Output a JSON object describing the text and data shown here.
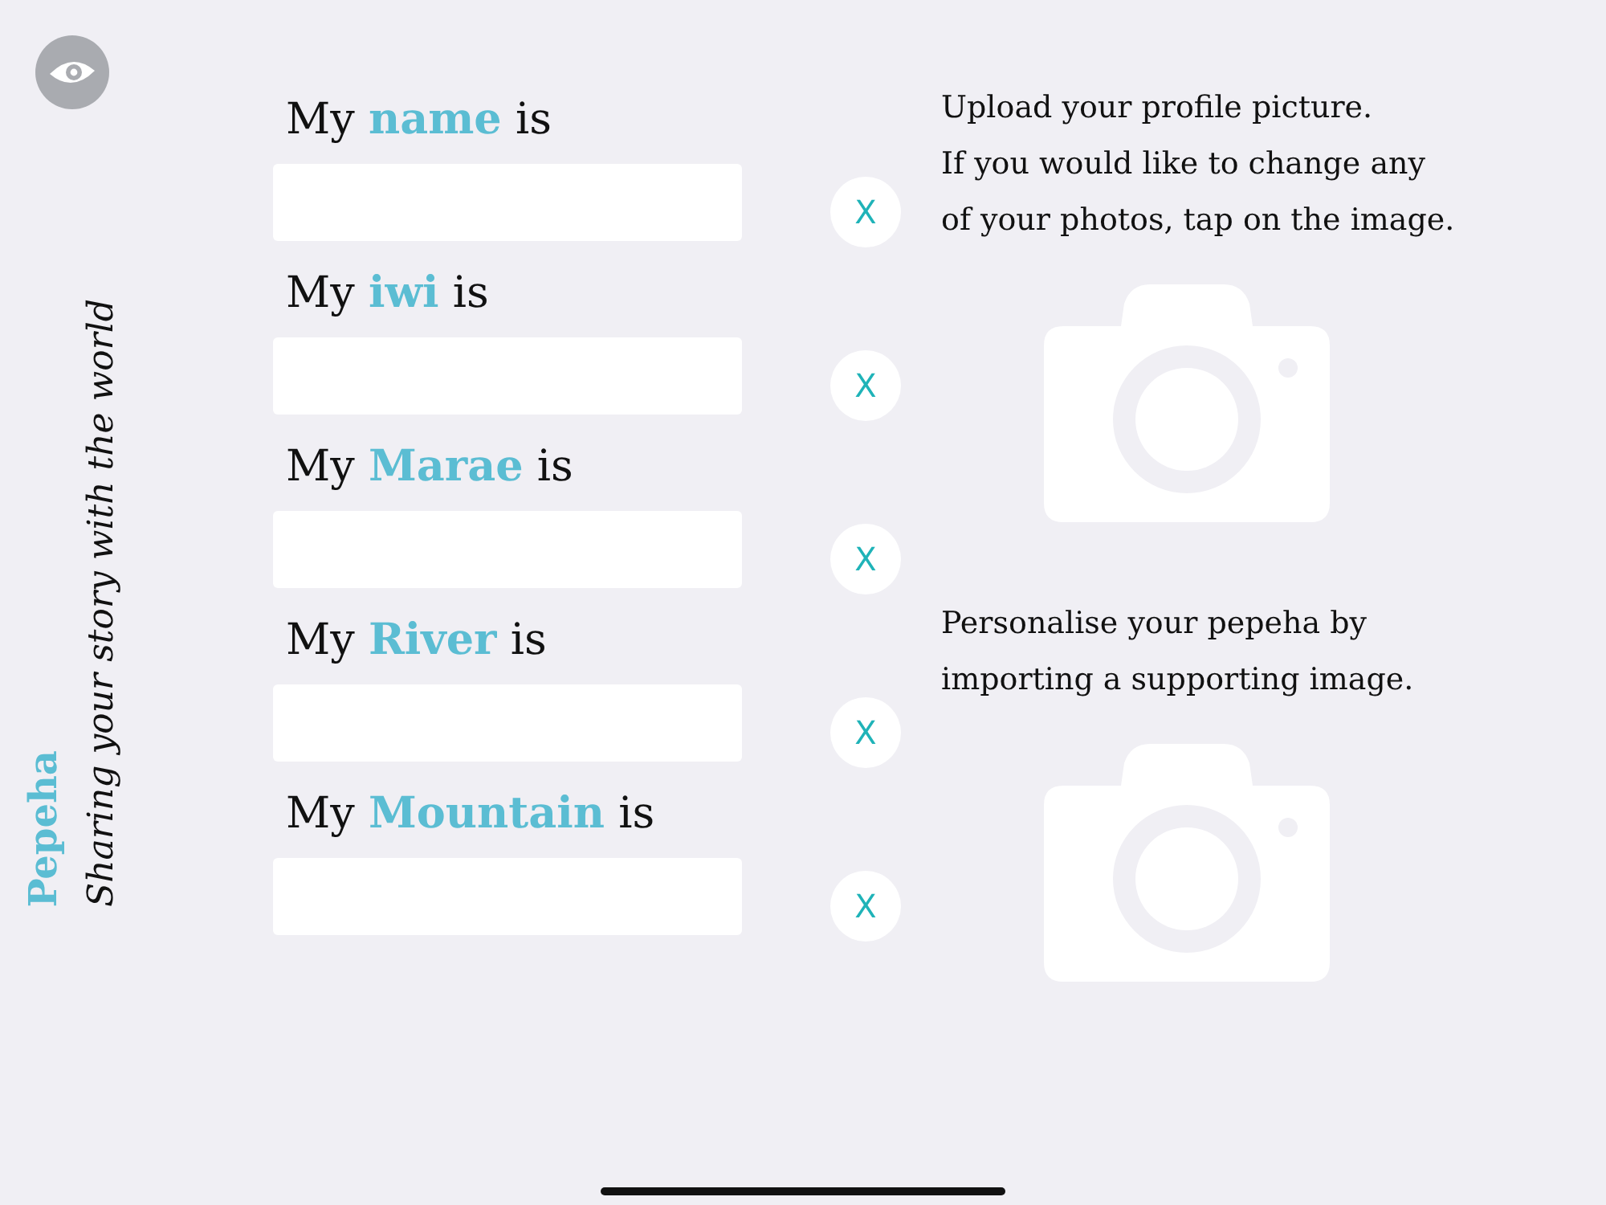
{
  "sidebar": {
    "title": "Pepeha",
    "subtitle": "Sharing your story with the world"
  },
  "fields": [
    {
      "label": "My **name** is",
      "clear": "X"
    },
    {
      "label": "My **iwi** is",
      "clear": "X"
    },
    {
      "label": "My **Marae** is",
      "clear": "X"
    },
    {
      "label": "My **River** is",
      "clear": "X"
    },
    {
      "label": "My **Mountain** is",
      "clear": "X"
    }
  ],
  "photos": [
    {
      "caption": "Upload your profile picture.\nIf you would like to change any of your photos, tap on the image.",
      "kind": "picture"
    },
    {
      "caption": "Personalise your pepeha by importing a supporting image.",
      "kind": "picture"
    }
  ]
}
